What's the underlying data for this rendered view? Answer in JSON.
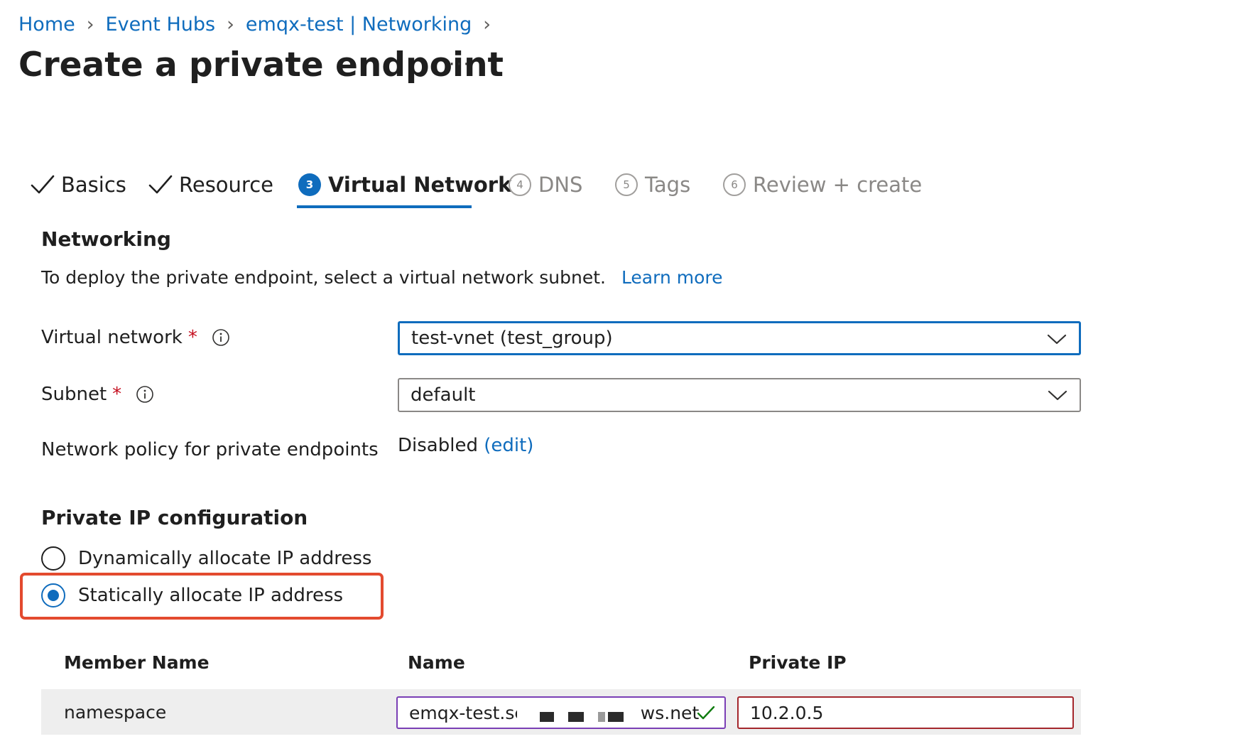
{
  "breadcrumb": {
    "items": [
      "Home",
      "Event Hubs",
      "emqx-test | Networking"
    ]
  },
  "page": {
    "title": "Create a private endpoint",
    "more_label": "···"
  },
  "tabs": [
    {
      "label": "Basics",
      "state": "completed"
    },
    {
      "label": "Resource",
      "state": "completed"
    },
    {
      "label": "Virtual Network",
      "step": "3",
      "state": "active"
    },
    {
      "label": "DNS",
      "step": "4",
      "state": "inactive"
    },
    {
      "label": "Tags",
      "step": "5",
      "state": "inactive"
    },
    {
      "label": "Review + create",
      "step": "6",
      "state": "inactive"
    }
  ],
  "networking": {
    "heading": "Networking",
    "description": "To deploy the private endpoint, select a virtual network subnet.",
    "learn_more": "Learn more",
    "virtual_network": {
      "label": "Virtual network",
      "required_mark": "*",
      "value": "test-vnet (test_group)"
    },
    "subnet": {
      "label": "Subnet",
      "required_mark": "*",
      "value": "default"
    },
    "policy": {
      "label": "Network policy for private endpoints",
      "value": "Disabled",
      "edit_label": "(edit)"
    }
  },
  "ip_config": {
    "heading": "Private IP configuration",
    "options": [
      {
        "label": "Dynamically allocate IP address",
        "selected": false
      },
      {
        "label": "Statically allocate IP address",
        "selected": true
      }
    ]
  },
  "table": {
    "headers": [
      "Member Name",
      "Name",
      "Private IP"
    ],
    "rows": [
      {
        "member_name": "namespace",
        "name_prefix": "emqx-test.se",
        "name_suffix": "ws.net",
        "private_ip": "10.2.0.5"
      }
    ]
  },
  "colors": {
    "accent": "#0f6cbd",
    "required": "#c50f1f",
    "highlight": "#e34a2f",
    "valid": "#107c10",
    "error_border": "#a4262c"
  }
}
